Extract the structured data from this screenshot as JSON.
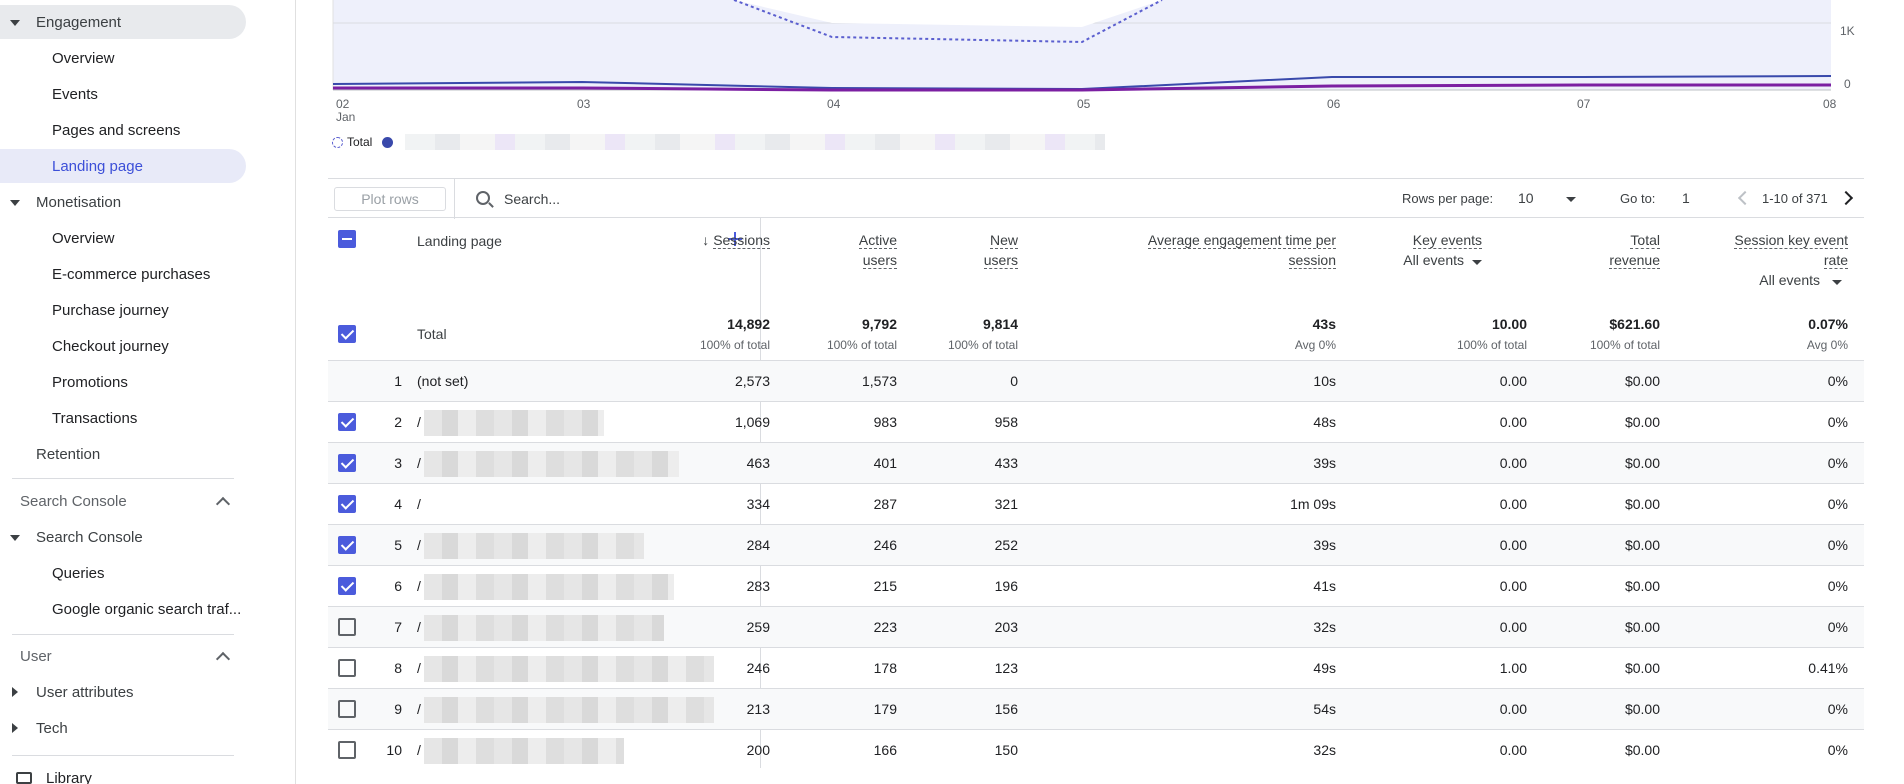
{
  "sidebar": {
    "engagement": "Engagement",
    "engagement_items": [
      "Overview",
      "Events",
      "Pages and screens",
      "Landing page"
    ],
    "monetisation": "Monetisation",
    "monetisation_items": [
      "Overview",
      "E-commerce purchases",
      "Purchase journey",
      "Checkout journey",
      "Promotions",
      "Transactions"
    ],
    "retention": "Retention",
    "search_console_section": "Search Console",
    "search_console": "Search Console",
    "search_console_items": [
      "Queries",
      "Google organic search traf..."
    ],
    "user_section": "User",
    "user_items": [
      "User attributes",
      "Tech"
    ],
    "library": "Library"
  },
  "chart_data": {
    "type": "line",
    "x": [
      "02",
      "03",
      "04",
      "05",
      "06",
      "07",
      "08"
    ],
    "x_sublabel": "Jan",
    "y_ticks": [
      "1K",
      "0"
    ],
    "legend": [
      "Total"
    ],
    "colors": {
      "total": "#5b5fcf",
      "fill": "#eef0fb",
      "series1": "#3949ab",
      "series2": "#7b1fa2"
    }
  },
  "toolbar": {
    "plot_rows": "Plot rows",
    "search_placeholder": "Search...",
    "rows_per_page_label": "Rows per page:",
    "rows_per_page": "10",
    "goto_label": "Go to:",
    "goto_value": "1",
    "range": "1-10 of 371"
  },
  "table": {
    "dimension_header": "Landing page",
    "headers": {
      "sessions": "Sessions",
      "active_users_1": "Active",
      "active_users_2": "users",
      "new_users_1": "New",
      "new_users_2": "users",
      "avg_eng_1": "Average engagement time per",
      "avg_eng_2": "session",
      "key_events": "Key events",
      "key_events_sub": "All events",
      "revenue_1": "Total",
      "revenue_2": "revenue",
      "rate_1": "Session key event",
      "rate_2": "rate",
      "rate_sub": "All events"
    },
    "total": {
      "label": "Total",
      "values": [
        "14,892",
        "9,792",
        "9,814",
        "43s",
        "10.00",
        "$621.60",
        "0.07%"
      ],
      "subs": [
        "100% of total",
        "100% of total",
        "100% of total",
        "Avg 0%",
        "100% of total",
        "100% of total",
        "Avg 0%"
      ]
    },
    "rows": [
      {
        "n": "1",
        "page": "(not set)",
        "v": [
          "2,573",
          "1,573",
          "0",
          "10s",
          "0.00",
          "$0.00",
          "0%"
        ],
        "checked": false,
        "hidebox": true
      },
      {
        "n": "2",
        "page": "/",
        "v": [
          "1,069",
          "983",
          "958",
          "48s",
          "0.00",
          "$0.00",
          "0%"
        ],
        "checked": true
      },
      {
        "n": "3",
        "page": "/",
        "v": [
          "463",
          "401",
          "433",
          "39s",
          "0.00",
          "$0.00",
          "0%"
        ],
        "checked": true
      },
      {
        "n": "4",
        "page": "/",
        "v": [
          "334",
          "287",
          "321",
          "1m 09s",
          "0.00",
          "$0.00",
          "0%"
        ],
        "checked": true
      },
      {
        "n": "5",
        "page": "/",
        "v": [
          "284",
          "246",
          "252",
          "39s",
          "0.00",
          "$0.00",
          "0%"
        ],
        "checked": true
      },
      {
        "n": "6",
        "page": "/",
        "v": [
          "283",
          "215",
          "196",
          "41s",
          "0.00",
          "$0.00",
          "0%"
        ],
        "checked": true
      },
      {
        "n": "7",
        "page": "/",
        "v": [
          "259",
          "223",
          "203",
          "32s",
          "0.00",
          "$0.00",
          "0%"
        ],
        "checked": false
      },
      {
        "n": "8",
        "page": "/",
        "v": [
          "246",
          "178",
          "123",
          "49s",
          "1.00",
          "$0.00",
          "0.41%"
        ],
        "checked": false
      },
      {
        "n": "9",
        "page": "/",
        "v": [
          "213",
          "179",
          "156",
          "54s",
          "0.00",
          "$0.00",
          "0%"
        ],
        "checked": false
      },
      {
        "n": "10",
        "page": "/",
        "v": [
          "200",
          "166",
          "150",
          "32s",
          "0.00",
          "$0.00",
          "0%"
        ],
        "checked": false
      }
    ]
  }
}
